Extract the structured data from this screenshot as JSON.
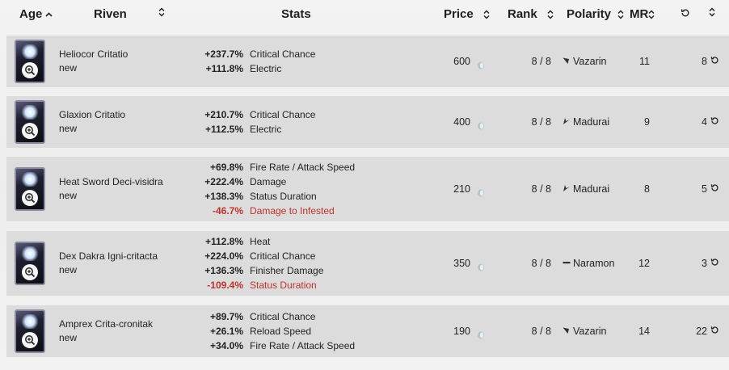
{
  "header": {
    "age": "Age",
    "riven": "Riven",
    "stats": "Stats",
    "price": "Price",
    "rank": "Rank",
    "polarity": "Polarity",
    "mr": "MR"
  },
  "rows": [
    {
      "name": "Heliocor Critatio",
      "status": "new",
      "stats": [
        {
          "value": "+237.7%",
          "label": "Critical Chance",
          "negative": false
        },
        {
          "value": "+111.8%",
          "label": "Electric",
          "negative": false
        }
      ],
      "price": "600",
      "rank": "8 / 8",
      "polarity": "Vazarin",
      "polarity_icon": "vazarin-icon",
      "mr": "11",
      "rerolls": "8"
    },
    {
      "name": "Glaxion Critatio",
      "status": "new",
      "stats": [
        {
          "value": "+210.7%",
          "label": "Critical Chance",
          "negative": false
        },
        {
          "value": "+112.5%",
          "label": "Electric",
          "negative": false
        }
      ],
      "price": "400",
      "rank": "8 / 8",
      "polarity": "Madurai",
      "polarity_icon": "madurai-icon",
      "mr": "9",
      "rerolls": "4"
    },
    {
      "name": "Heat Sword Deci-visidra",
      "status": "new",
      "stats": [
        {
          "value": "+69.8%",
          "label": "Fire Rate / Attack Speed",
          "negative": false
        },
        {
          "value": "+222.4%",
          "label": "Damage",
          "negative": false
        },
        {
          "value": "+138.3%",
          "label": "Status Duration",
          "negative": false
        },
        {
          "value": "-46.7%",
          "label": "Damage to Infested",
          "negative": true
        }
      ],
      "price": "210",
      "rank": "8 / 8",
      "polarity": "Madurai",
      "polarity_icon": "madurai-icon",
      "mr": "8",
      "rerolls": "5"
    },
    {
      "name": "Dex Dakra Igni-critacta",
      "status": "new",
      "stats": [
        {
          "value": "+112.8%",
          "label": "Heat",
          "negative": false
        },
        {
          "value": "+224.0%",
          "label": "Critical Chance",
          "negative": false
        },
        {
          "value": "+136.3%",
          "label": "Finisher Damage",
          "negative": false
        },
        {
          "value": "-109.4%",
          "label": "Status Duration",
          "negative": true
        }
      ],
      "price": "350",
      "rank": "8 / 8",
      "polarity": "Naramon",
      "polarity_icon": "naramon-icon",
      "mr": "12",
      "rerolls": "3"
    },
    {
      "name": "Amprex Crita-cronitak",
      "status": "new",
      "stats": [
        {
          "value": "+89.7%",
          "label": "Critical Chance",
          "negative": false
        },
        {
          "value": "+26.1%",
          "label": "Reload Speed",
          "negative": false
        },
        {
          "value": "+34.0%",
          "label": "Fire Rate / Attack Speed",
          "negative": false
        }
      ],
      "price": "190",
      "rank": "8 / 8",
      "polarity": "Vazarin",
      "polarity_icon": "vazarin-icon",
      "mr": "14",
      "rerolls": "22"
    }
  ],
  "colors": {
    "row_bg": "#dcdcdc",
    "negative": "#c0312b"
  }
}
